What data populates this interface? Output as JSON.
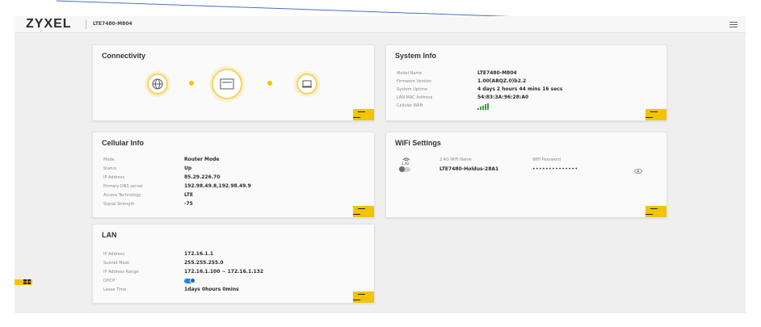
{
  "header": {
    "logo": "ZYXEL",
    "model": "LTE7480-M804"
  },
  "connectivity": {
    "title": "Connectivity"
  },
  "system_info": {
    "title": "System Info",
    "rows": [
      {
        "label": "Model Name",
        "value": "LTE7480-M804"
      },
      {
        "label": "Firmware Version",
        "value": "1.00(ABQZ.0)b2.2"
      },
      {
        "label": "System Uptime",
        "value": "4 days 2 hours 44 mins 16 secs"
      },
      {
        "label": "LAN MAC Address",
        "value": "54:83:3A:96:28:A0"
      },
      {
        "label": "Cellular WAN",
        "value": ""
      }
    ]
  },
  "cellular_info": {
    "title": "Cellular Info",
    "rows": [
      {
        "label": "Mode",
        "value": "Router Mode"
      },
      {
        "label": "Status",
        "value": "Up"
      },
      {
        "label": "IP Address",
        "value": "85.29.226.70"
      },
      {
        "label": "Primary DNS server",
        "value": "192.98.49.8,192.98.49.9"
      },
      {
        "label": "Access Technology",
        "value": "LTE"
      },
      {
        "label": "Signal Strength",
        "value": "-75"
      }
    ]
  },
  "wifi_settings": {
    "title": "WiFi Settings",
    "band_label": "2.4G",
    "name_header": "2.4G WiFi Name",
    "password_header": "WiFi Password",
    "wifi_name": "LTE7480-Holdus-28A1",
    "wifi_password": "••••••••••••••"
  },
  "lan": {
    "title": "LAN",
    "rows": [
      {
        "label": "IP Address",
        "value": "172.16.1.1"
      },
      {
        "label": "Subnet Mask",
        "value": "255.255.255.0"
      },
      {
        "label": "IP Address Range",
        "value": "172.16.1.100 ~ 172.16.1.132"
      },
      {
        "label": "DHCP",
        "value": ""
      },
      {
        "label": "Lease Time",
        "value": "1days 0hours 0mins"
      }
    ],
    "dhcp_enabled": true
  },
  "colors": {
    "accent": "#f2c400",
    "toggle_on": "#1e88e5",
    "signal": "#3aa335"
  }
}
